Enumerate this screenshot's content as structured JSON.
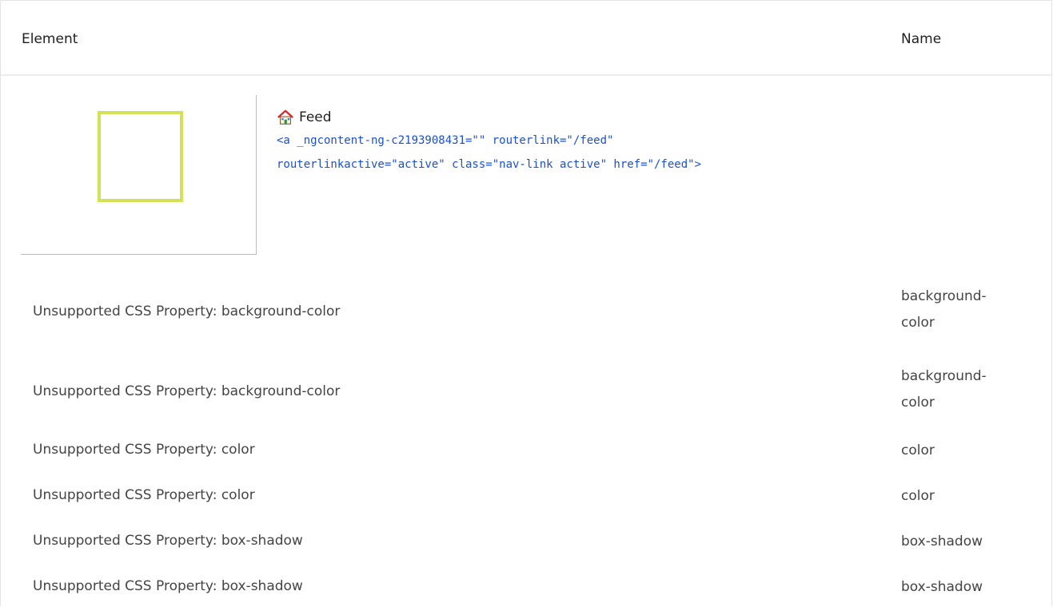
{
  "table": {
    "headers": {
      "element": "Element",
      "name": "Name"
    }
  },
  "element": {
    "icon": "house-icon",
    "title": "Feed",
    "code": "<a _ngcontent-ng-c2193908431=\"\" routerlink=\"/feed\" routerlinkactive=\"active\" class=\"nav-link active\" href=\"/feed\">",
    "preview_border_color": "#d4e157"
  },
  "rows": [
    {
      "message": "Unsupported CSS Property: background-color",
      "name_line1": "background-",
      "name_line2": "color"
    },
    {
      "message": "Unsupported CSS Property: background-color",
      "name_line1": "background-",
      "name_line2": "color"
    },
    {
      "message": "Unsupported CSS Property: color",
      "name": "color"
    },
    {
      "message": "Unsupported CSS Property: color",
      "name": "color"
    },
    {
      "message": "Unsupported CSS Property: box-shadow",
      "name": "box-shadow"
    },
    {
      "message": "Unsupported CSS Property: box-shadow",
      "name": "box-shadow"
    }
  ],
  "colors": {
    "code_text": "#1a4fd6",
    "border": "#e4e4e4"
  }
}
